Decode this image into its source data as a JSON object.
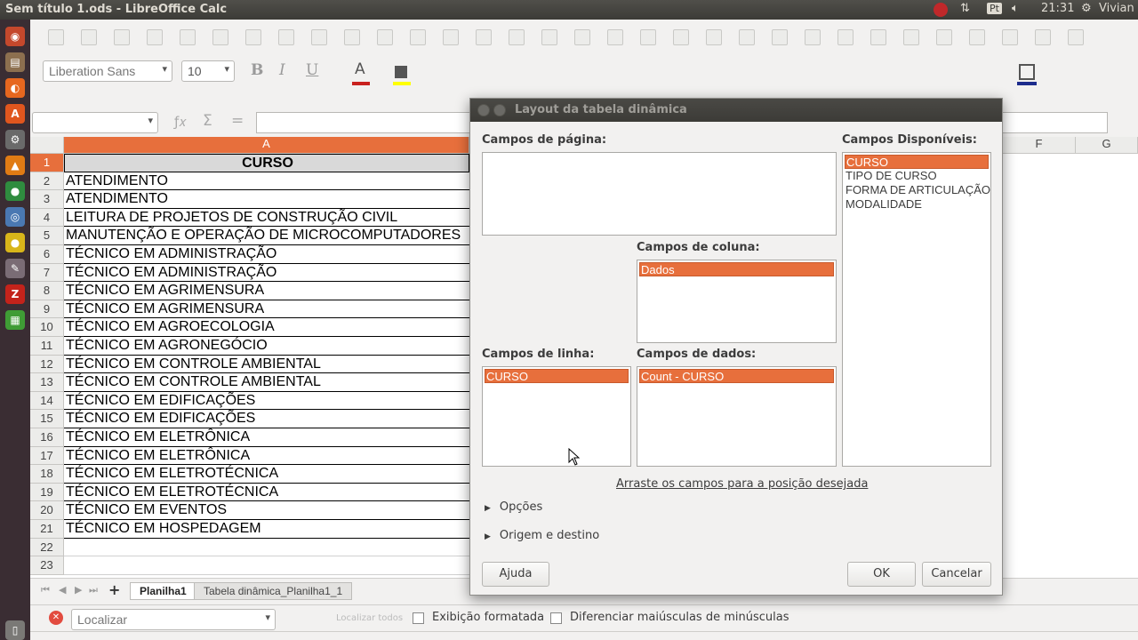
{
  "window": {
    "title": "Sem título 1.ods - LibreOffice Calc"
  },
  "tray": {
    "lang": "Pt",
    "time": "21:31",
    "user": "Vivian"
  },
  "launcher": {
    "items": [
      {
        "name": "dash-icon",
        "color": "#c4482c",
        "glyph": "◉"
      },
      {
        "name": "files-icon",
        "color": "#8c6f4f",
        "glyph": "▤"
      },
      {
        "name": "firefox-icon",
        "color": "#e6671f",
        "glyph": "◐"
      },
      {
        "name": "software-center-icon",
        "color": "#e0561e",
        "glyph": "A"
      },
      {
        "name": "settings-icon",
        "color": "#6a6a6a",
        "glyph": "⚙"
      },
      {
        "name": "vlc-icon",
        "color": "#e07b14",
        "glyph": "▲"
      },
      {
        "name": "chrome-icon",
        "color": "#2f8c3f",
        "glyph": "●"
      },
      {
        "name": "network-icon",
        "color": "#4a78b2",
        "glyph": "◎"
      },
      {
        "name": "notes-icon",
        "color": "#d8b51a",
        "glyph": "●"
      },
      {
        "name": "tool-icon",
        "color": "#7a6c75",
        "glyph": "✎"
      },
      {
        "name": "filezilla-icon",
        "color": "#c3231b",
        "glyph": "Z"
      },
      {
        "name": "calc-icon",
        "color": "#3f9c35",
        "glyph": "▦"
      },
      {
        "name": "trash-icon",
        "color": "#7a7976",
        "glyph": "▯"
      }
    ]
  },
  "format": {
    "font_name": "Liberation Sans",
    "font_size": "10"
  },
  "grid": {
    "columns": [
      "A",
      "F",
      "G"
    ],
    "rows": [
      {
        "n": "1",
        "v": "CURSO"
      },
      {
        "n": "2",
        "v": "ATENDIMENTO"
      },
      {
        "n": "3",
        "v": "ATENDIMENTO"
      },
      {
        "n": "4",
        "v": "LEITURA DE PROJETOS DE CONSTRUÇÃO CIVIL"
      },
      {
        "n": "5",
        "v": "MANUTENÇÃO E OPERAÇÃO DE MICROCOMPUTADORES"
      },
      {
        "n": "6",
        "v": "TÉCNICO EM ADMINISTRAÇÃO"
      },
      {
        "n": "7",
        "v": "TÉCNICO EM ADMINISTRAÇÃO"
      },
      {
        "n": "8",
        "v": "TÉCNICO EM AGRIMENSURA"
      },
      {
        "n": "9",
        "v": "TÉCNICO EM AGRIMENSURA"
      },
      {
        "n": "10",
        "v": "TÉCNICO EM AGROECOLOGIA"
      },
      {
        "n": "11",
        "v": "TÉCNICO EM AGRONEGÓCIO"
      },
      {
        "n": "12",
        "v": "TÉCNICO EM CONTROLE AMBIENTAL"
      },
      {
        "n": "13",
        "v": "TÉCNICO EM CONTROLE AMBIENTAL"
      },
      {
        "n": "14",
        "v": "TÉCNICO EM EDIFICAÇÕES"
      },
      {
        "n": "15",
        "v": "TÉCNICO EM EDIFICAÇÕES"
      },
      {
        "n": "16",
        "v": "TÉCNICO EM ELETRÔNICA"
      },
      {
        "n": "17",
        "v": "TÉCNICO EM ELETRÔNICA"
      },
      {
        "n": "18",
        "v": "TÉCNICO EM ELETROTÉCNICA"
      },
      {
        "n": "19",
        "v": "TÉCNICO EM ELETROTÉCNICA"
      },
      {
        "n": "20",
        "v": "TÉCNICO EM EVENTOS"
      },
      {
        "n": "21",
        "v": "TÉCNICO EM HOSPEDAGEM"
      },
      {
        "n": "22",
        "v": ""
      },
      {
        "n": "23",
        "v": ""
      }
    ]
  },
  "sheets": {
    "add": "+",
    "tabs": [
      "Planilha1",
      "Tabela dinâmica_Planilha1_1"
    ]
  },
  "findbar": {
    "placeholder": "Localizar",
    "find_all": "Localizar todos",
    "formatted": "Exibição formatada",
    "match_case": "Diferenciar maiúsculas de minúsculas"
  },
  "dialog": {
    "title": "Layout da tabela dinâmica",
    "page_fields_label": "Campos de página:",
    "column_fields_label": "Campos de coluna:",
    "row_fields_label": "Campos de linha:",
    "data_fields_label": "Campos de dados:",
    "available_fields_label": "Campos Disponíveis:",
    "column_fields": [
      "Dados"
    ],
    "row_fields": [
      "CURSO"
    ],
    "data_fields": [
      "Count - CURSO"
    ],
    "available_fields": [
      "CURSO",
      "TIPO DE CURSO",
      "FORMA DE ARTICULAÇÃO",
      "MODALIDADE"
    ],
    "hint": "Arraste os campos para a posição desejada",
    "options": "Opções",
    "source": "Origem e destino",
    "help": "Ajuda",
    "ok": "OK",
    "cancel": "Cancelar"
  }
}
